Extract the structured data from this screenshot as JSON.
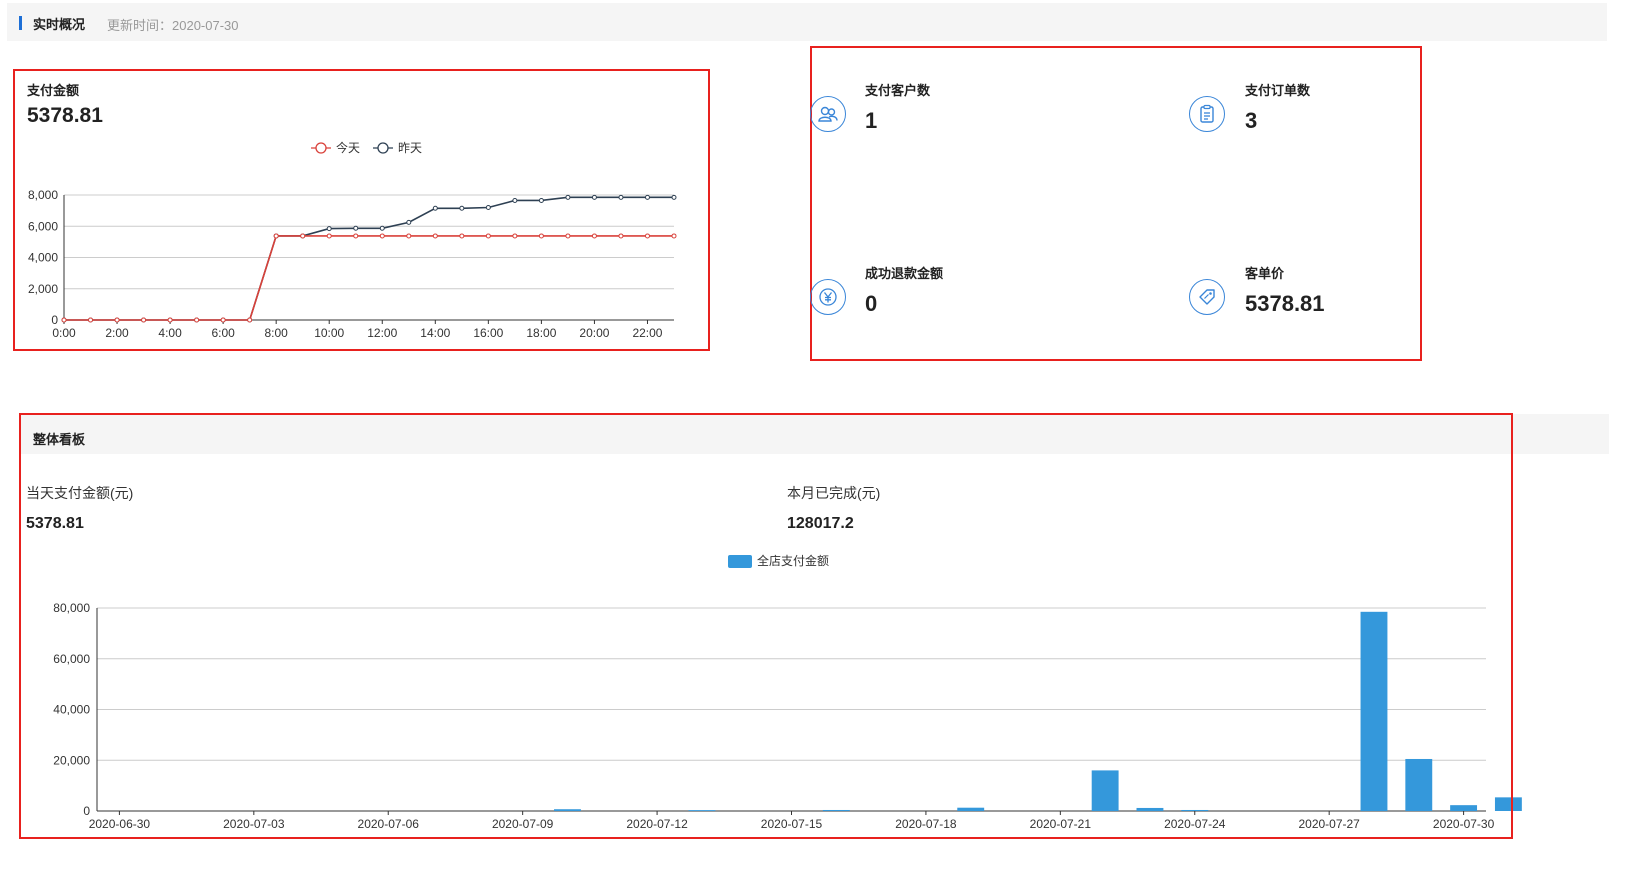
{
  "header": {
    "title": "实时概况",
    "update_time": "更新时间：2020-07-30"
  },
  "pay_amount_card": {
    "title": "支付金额",
    "value": "5378.81"
  },
  "stats": {
    "customers": {
      "label": "支付客户数",
      "value": "1",
      "icon": "users-icon"
    },
    "orders": {
      "label": "支付订单数",
      "value": "3",
      "icon": "clipboard-icon"
    },
    "refund": {
      "label": "成功退款金额",
      "value": "0",
      "icon": "yen-icon"
    },
    "unit_price": {
      "label": "客单价",
      "value": "5378.81",
      "icon": "tag-icon"
    }
  },
  "board": {
    "title": "整体看板",
    "today_label": "当天支付金额(元)",
    "today_value": "5378.81",
    "month_label": "本月已完成(元)",
    "month_value": "128017.2"
  },
  "chart_data": [
    {
      "type": "line",
      "x": [
        "0:00",
        "1:00",
        "2:00",
        "3:00",
        "4:00",
        "5:00",
        "6:00",
        "7:00",
        "8:00",
        "9:00",
        "10:00",
        "11:00",
        "12:00",
        "13:00",
        "14:00",
        "15:00",
        "16:00",
        "17:00",
        "18:00",
        "19:00",
        "20:00",
        "21:00",
        "22:00",
        "23:00"
      ],
      "xticks": [
        "0:00",
        "2:00",
        "4:00",
        "6:00",
        "8:00",
        "10:00",
        "12:00",
        "14:00",
        "16:00",
        "18:00",
        "20:00",
        "22:00"
      ],
      "yticks": [
        "0",
        "2,000",
        "4,000",
        "6,000",
        "8,000"
      ],
      "ylim": [
        0,
        8000
      ],
      "grid": true,
      "legend_position": "top-center",
      "series": [
        {
          "name": "今天",
          "color": "#d9413a",
          "values": [
            0,
            0,
            0,
            0,
            0,
            0,
            0,
            0,
            5380,
            5380,
            5380,
            5380,
            5380,
            5380,
            5380,
            5380,
            5380,
            5380,
            5380,
            5380,
            5380,
            5380,
            5380,
            5380
          ]
        },
        {
          "name": "昨天",
          "color": "#2e4053",
          "values": [
            0,
            0,
            0,
            0,
            0,
            0,
            0,
            0,
            5380,
            5380,
            5850,
            5870,
            5870,
            6250,
            7150,
            7150,
            7200,
            7650,
            7650,
            7850,
            7850,
            7850,
            7850,
            7850
          ]
        }
      ]
    },
    {
      "type": "bar",
      "categories": [
        "2020-06-30",
        "2020-07-01",
        "2020-07-02",
        "2020-07-03",
        "2020-07-04",
        "2020-07-05",
        "2020-07-06",
        "2020-07-07",
        "2020-07-08",
        "2020-07-09",
        "2020-07-10",
        "2020-07-11",
        "2020-07-12",
        "2020-07-13",
        "2020-07-14",
        "2020-07-15",
        "2020-07-16",
        "2020-07-17",
        "2020-07-18",
        "2020-07-19",
        "2020-07-20",
        "2020-07-21",
        "2020-07-22",
        "2020-07-23",
        "2020-07-24",
        "2020-07-25",
        "2020-07-26",
        "2020-07-27",
        "2020-07-28",
        "2020-07-29",
        "2020-07-30"
      ],
      "xticks": [
        "2020-06-30",
        "2020-07-03",
        "2020-07-06",
        "2020-07-09",
        "2020-07-12",
        "2020-07-15",
        "2020-07-18",
        "2020-07-21",
        "2020-07-24",
        "2020-07-27",
        "2020-07-30"
      ],
      "yticks": [
        "0",
        "20,000",
        "40,000",
        "60,000",
        "80,000"
      ],
      "ylim": [
        0,
        80000
      ],
      "grid": true,
      "legend_position": "top-center",
      "series": [
        {
          "name": "全店支付金额",
          "color": "#3498db",
          "values": [
            0,
            0,
            0,
            0,
            0,
            0,
            0,
            0,
            0,
            0,
            700,
            0,
            0,
            350,
            0,
            0,
            400,
            0,
            0,
            1300,
            0,
            0,
            16000,
            1200,
            400,
            0,
            0,
            0,
            78500,
            20500,
            2300,
            5378.81
          ]
        }
      ]
    }
  ]
}
